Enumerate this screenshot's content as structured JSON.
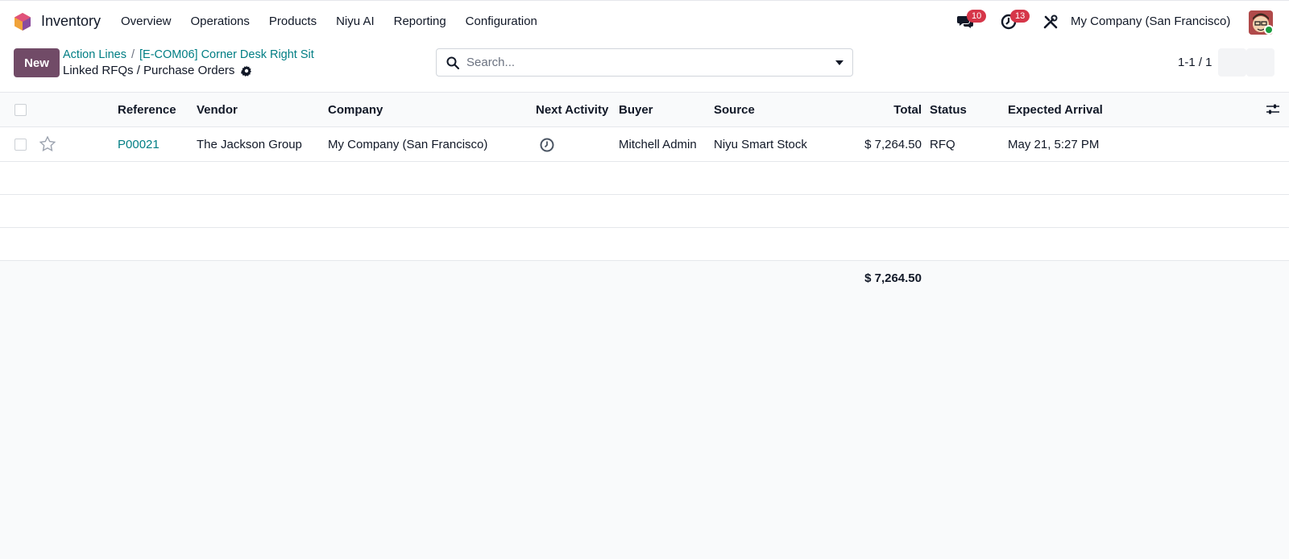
{
  "navbar": {
    "app_name": "Inventory",
    "menu": [
      "Overview",
      "Operations",
      "Products",
      "Niyu AI",
      "Reporting",
      "Configuration"
    ],
    "messages_count": "10",
    "activities_count": "13",
    "company": "My Company (San Francisco)"
  },
  "control": {
    "new_label": "New",
    "breadcrumb": [
      "Action Lines",
      "[E-COM06] Corner Desk Right Sit"
    ],
    "breadcrumb_sep": "/",
    "title": "Linked RFQs / Purchase Orders",
    "search_placeholder": "Search...",
    "pager": "1-1 / 1"
  },
  "table": {
    "columns": {
      "reference": "Reference",
      "vendor": "Vendor",
      "company": "Company",
      "next_activity": "Next Activity",
      "buyer": "Buyer",
      "source": "Source",
      "total": "Total",
      "status": "Status",
      "expected_arrival": "Expected Arrival"
    },
    "rows": [
      {
        "reference": "P00021",
        "vendor": "The Jackson Group",
        "company": "My Company (San Francisco)",
        "next_activity_icon": "clock-icon",
        "buyer": "Mitchell Admin",
        "source": "Niyu Smart Stock",
        "total": "$ 7,264.50",
        "status": "RFQ",
        "expected_arrival": "May 21, 5:27 PM"
      }
    ],
    "sum_total": "$ 7,264.50"
  },
  "colors": {
    "brand": "#714b67",
    "link": "#017e84",
    "badge": "#d63649"
  }
}
